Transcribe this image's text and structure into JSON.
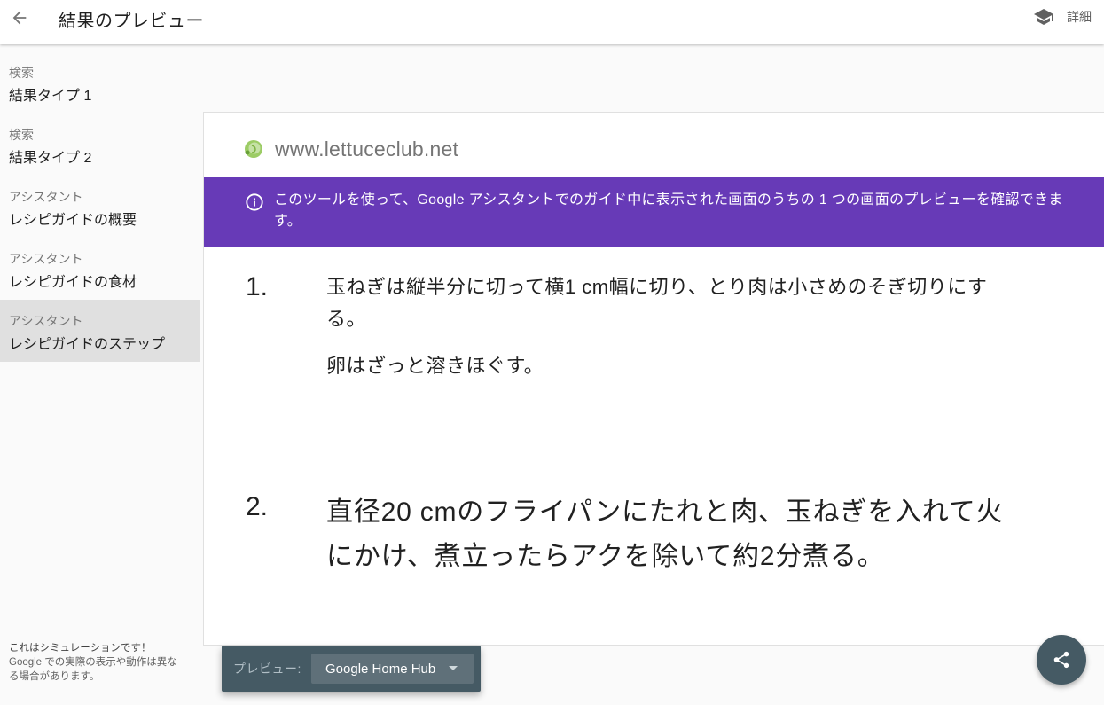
{
  "header": {
    "title": "結果のプレビュー",
    "back_icon": "arrow-back-icon",
    "details_label": "詳細",
    "details_icon": "school-cap-icon"
  },
  "sidebar": {
    "items": [
      {
        "category": "検索",
        "label": "結果タイプ 1",
        "active": false
      },
      {
        "category": "検索",
        "label": "結果タイプ 2",
        "active": false
      },
      {
        "category": "アシスタント",
        "label": "レシピガイドの概要",
        "active": false
      },
      {
        "category": "アシスタント",
        "label": "レシピガイドの食材",
        "active": false
      },
      {
        "category": "アシスタント",
        "label": "レシピガイドのステップ",
        "active": true
      }
    ],
    "note_line1": "これはシミュレーションです！",
    "note_line2": "Google での実際の表示や動作は異なる場合があります。"
  },
  "preview": {
    "site_icon": "lettuce-favicon-icon",
    "site_url": "www.lettuceclub.net",
    "banner_icon": "info-icon",
    "banner_color": "#673ab7",
    "banner_text": "このツールを使って、Google アシスタントでのガイド中に表示された画面のうちの 1 つの画面のプレビューを確認できます。",
    "steps": [
      {
        "number": "1.",
        "text": "玉ねぎは縦半分に切って横1 cm幅に切り、とり肉は小さめのそぎ切りにする。",
        "extra": "卵はざっと溶きほぐす。"
      },
      {
        "number": "2.",
        "text": "直径20 cmのフライパンにたれと肉、玉ねぎを入れて火にかけ、煮立ったらアクを除いて約2分煮る。"
      }
    ]
  },
  "toolbar": {
    "preview_label": "プレビュー:",
    "device_selected": "Google Home Hub",
    "toolbar_color": "#455a64"
  },
  "fab": {
    "icon": "share-icon"
  }
}
